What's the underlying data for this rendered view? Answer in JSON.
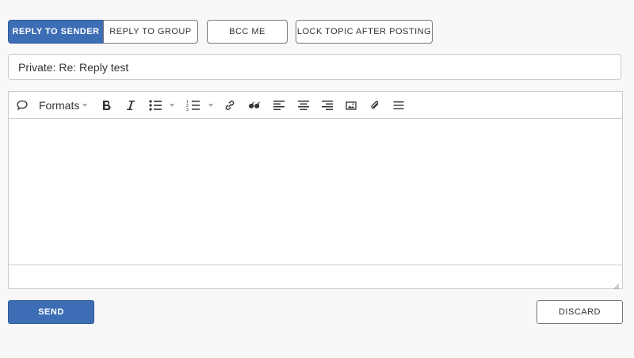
{
  "header": {
    "reply_to_sender_label": "Reply to Sender",
    "reply_to_group_label": "Reply to Group",
    "bcc_me_label": "BCC Me",
    "lock_topic_label": "Lock Topic after Posting"
  },
  "subject": {
    "value": "Private: Re: Reply test"
  },
  "toolbar": {
    "formats_label": "Formats",
    "icons": [
      "comment-icon",
      "bold-icon",
      "italic-icon",
      "bullet-list-icon",
      "numbered-list-icon",
      "link-icon",
      "blockquote-icon",
      "align-left-icon",
      "align-center-icon",
      "align-right-icon",
      "image-icon",
      "attachment-icon",
      "menu-icon"
    ]
  },
  "footer": {
    "send_label": "Send",
    "discard_label": "Discard"
  },
  "colors": {
    "primary": "#3d6eb5",
    "background": "#f8f8f8",
    "border": "#cccccc"
  }
}
